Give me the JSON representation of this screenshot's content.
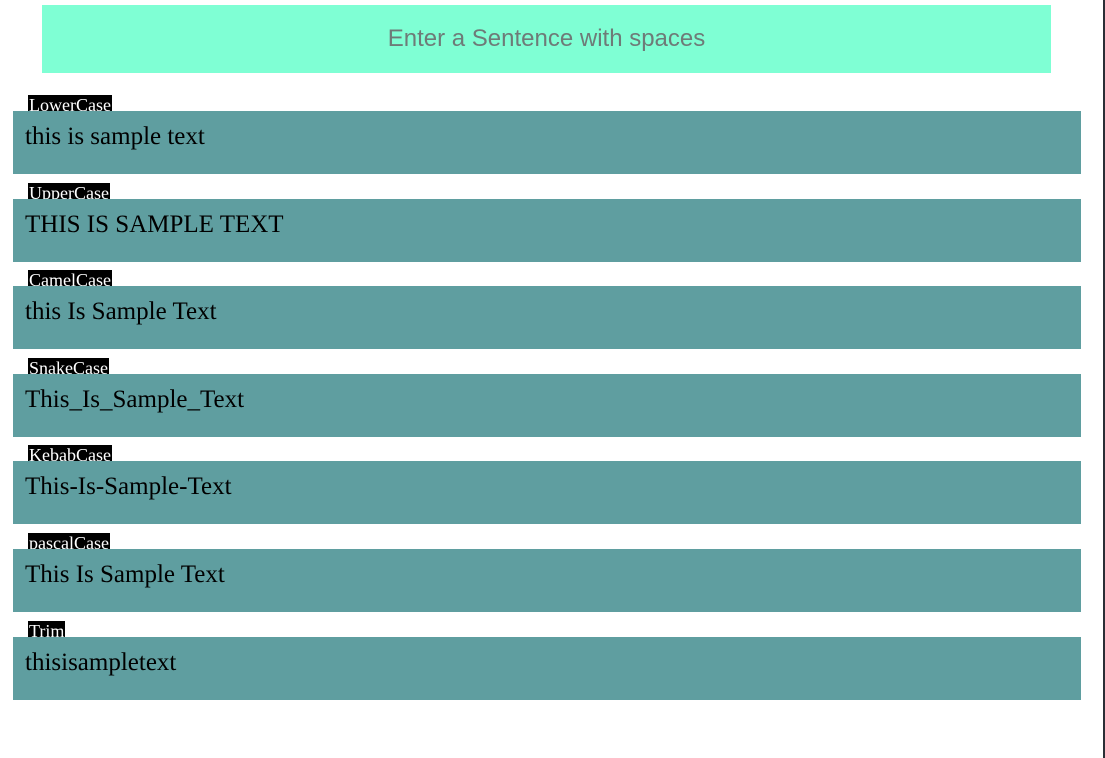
{
  "input": {
    "placeholder": "Enter a Sentence with spaces",
    "value": ""
  },
  "colors": {
    "input_background": "#7fffd4",
    "output_background": "#5f9ea0",
    "label_background": "#000000",
    "label_text": "#ffffff"
  },
  "results": [
    {
      "label": "LowerCase",
      "value": "this is sample text"
    },
    {
      "label": "UpperCase",
      "value": "THIS IS SAMPLE TEXT"
    },
    {
      "label": "CamelCase",
      "value": "this Is Sample Text"
    },
    {
      "label": "SnakeCase",
      "value": "This_Is_Sample_Text"
    },
    {
      "label": "KebabCase",
      "value": "This-Is-Sample-Text"
    },
    {
      "label": "pascalCase",
      "value": "This Is Sample Text"
    },
    {
      "label": "Trim",
      "value": "thisisampletext"
    }
  ]
}
